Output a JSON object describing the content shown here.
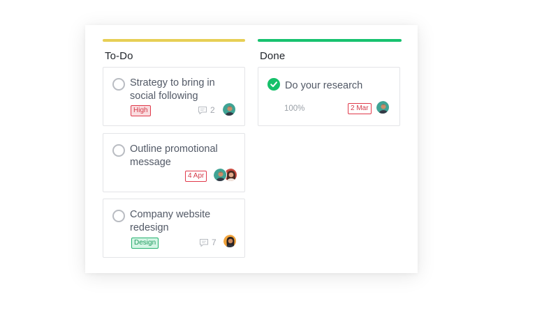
{
  "columns": [
    {
      "title": "To-Do",
      "accent": "#e7cf55",
      "cards": [
        {
          "title": "Strategy to bring in social following",
          "tag": "High",
          "comments": "2",
          "avatars": [
            "teal-man-avatar"
          ]
        },
        {
          "title": "Outline promotional message",
          "date": "4 Apr",
          "avatars": [
            "teal-man-avatar",
            "red-woman-avatar"
          ]
        },
        {
          "title": "Company website redesign",
          "tag": "Design",
          "comments": "7",
          "avatars": [
            "orange-woman-avatar"
          ]
        }
      ]
    },
    {
      "title": "Done",
      "accent": "#17c26f",
      "cards": [
        {
          "title": "Do your research",
          "progress": "100%",
          "date": "2 Mar",
          "avatars": [
            "teal-man-avatar"
          ],
          "completed": true
        }
      ]
    }
  ]
}
